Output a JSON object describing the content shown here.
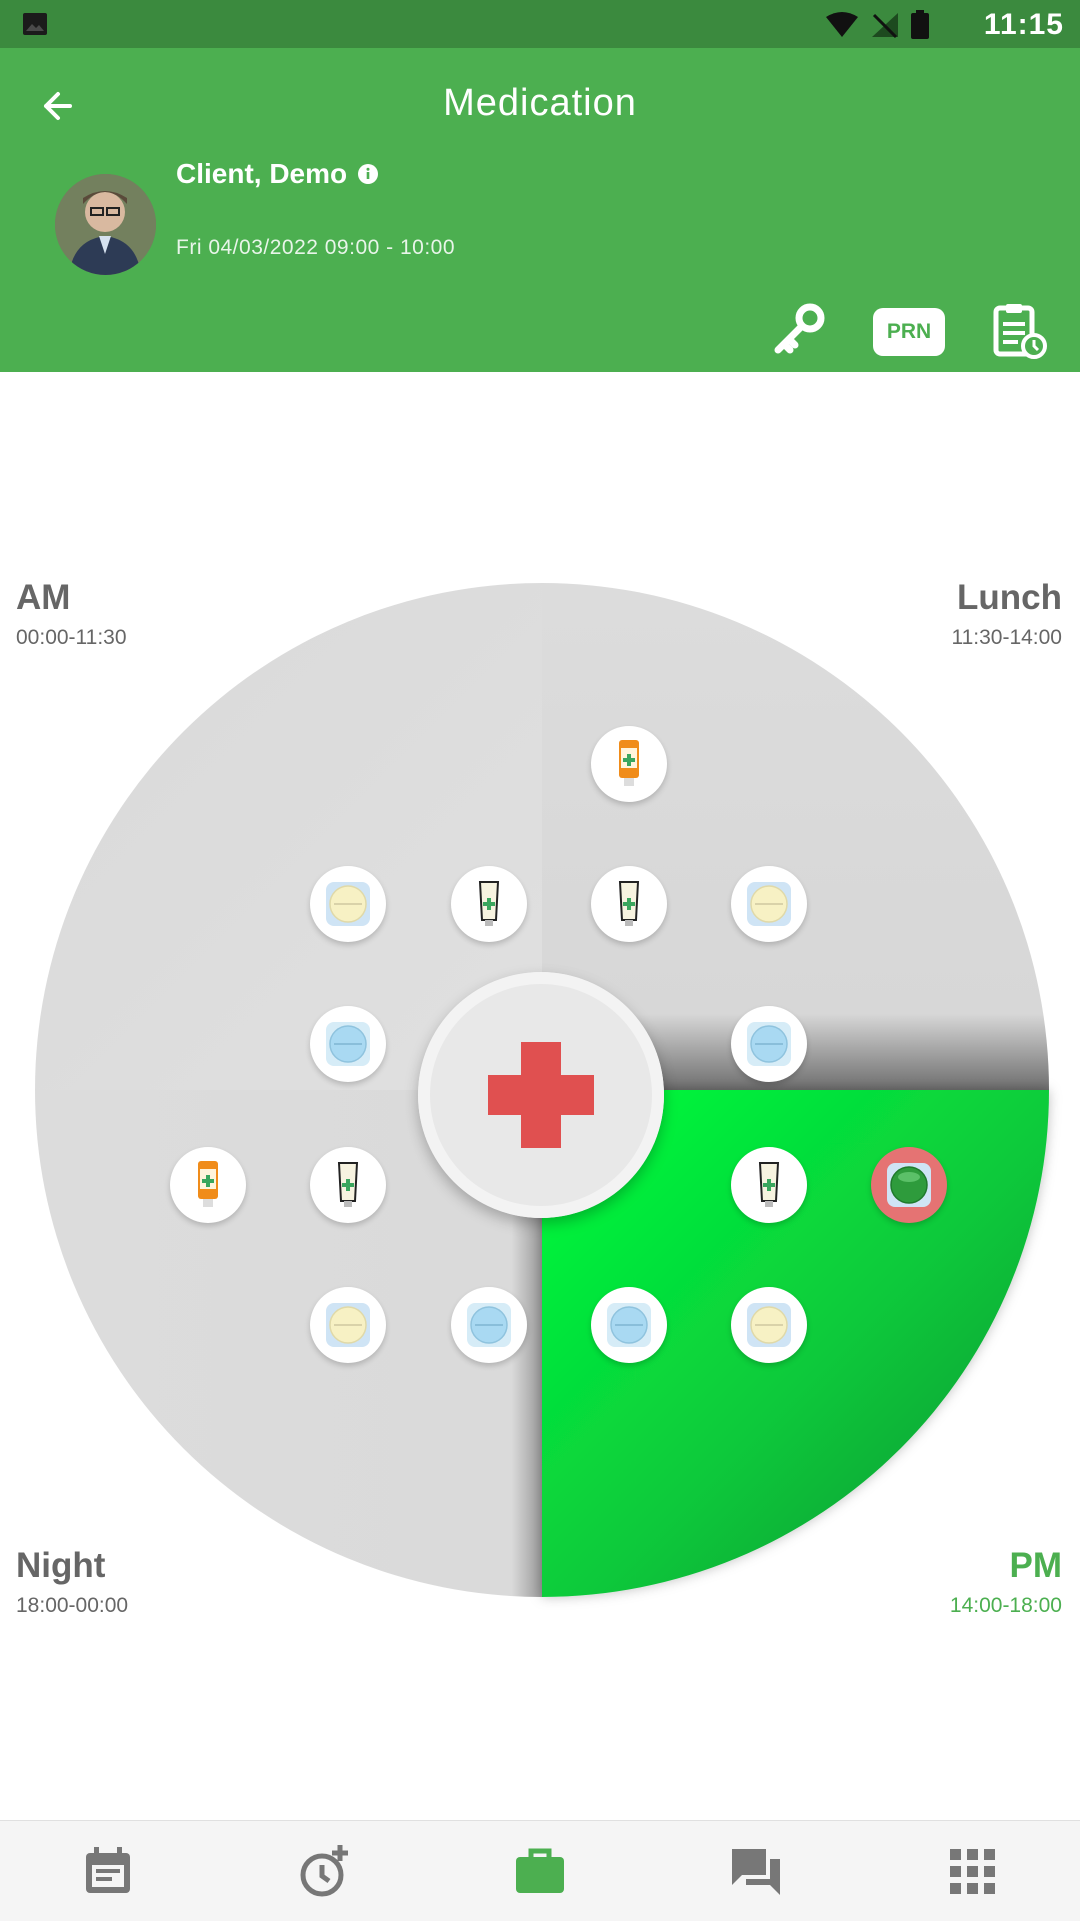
{
  "status_bar": {
    "time": "11:15",
    "icons": [
      "gallery-icon",
      "wifi-icon",
      "no-signal-icon",
      "battery-icon"
    ]
  },
  "header": {
    "title": "Medication",
    "client_name": "Client, Demo",
    "visit": "Fri 04/03/2022  09:00 - 10:00",
    "prn_label": "PRN"
  },
  "periods": {
    "am": {
      "label": "AM",
      "time": "00:00-11:30"
    },
    "lunch": {
      "label": "Lunch",
      "time": "11:30-14:00"
    },
    "pm": {
      "label": "PM",
      "time": "14:00-18:00",
      "active": true
    },
    "night": {
      "label": "Night",
      "time": "18:00-00:00"
    }
  },
  "colors": {
    "primary": "#4caf50",
    "status_bar": "#3b8a3e",
    "active_segment": "#00e43a",
    "cross": "#e05050",
    "alert": "#e57373"
  },
  "bottom_nav": [
    "calendar-icon",
    "add-alarm-icon",
    "briefcase-icon",
    "chat-icon",
    "apps-grid-icon"
  ],
  "bottom_nav_active": "briefcase-icon"
}
